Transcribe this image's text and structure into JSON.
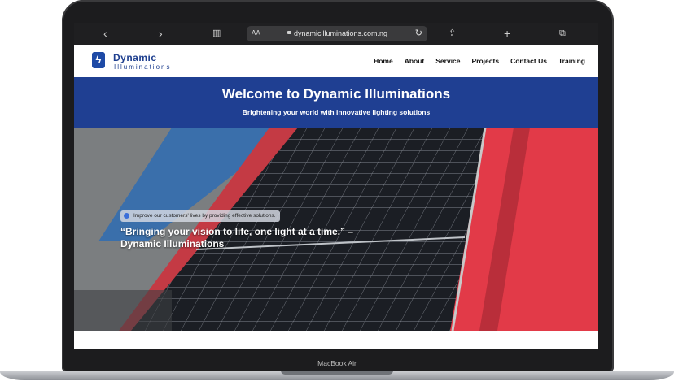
{
  "device": {
    "label": "MacBook Air"
  },
  "browser": {
    "text_size_label": "AA",
    "url": "dynamicilluminations.com.ng",
    "icons": [
      "back-icon",
      "forward-icon",
      "book-icon",
      "lock-icon",
      "reload-icon",
      "share-icon",
      "plus-icon",
      "tabs-icon"
    ]
  },
  "site": {
    "logo": {
      "line1": "Dynamic",
      "line2": "Illuminations"
    },
    "nav": [
      "Home",
      "About",
      "Service",
      "Projects",
      "Contact Us",
      "Training"
    ],
    "hero": {
      "title": "Welcome to Dynamic Illuminations",
      "subtitle": "Brightening your world with innovative lighting solutions"
    },
    "tag": "Improve our customers' lives by providing effective solutions.",
    "quote": "“Bringing your vision to life, one light at a time.” – Dynamic Illuminations",
    "colors": {
      "brand": "#1f3f92",
      "roof_red": "#e23a48",
      "roof_blue": "#2f6cb3"
    }
  }
}
